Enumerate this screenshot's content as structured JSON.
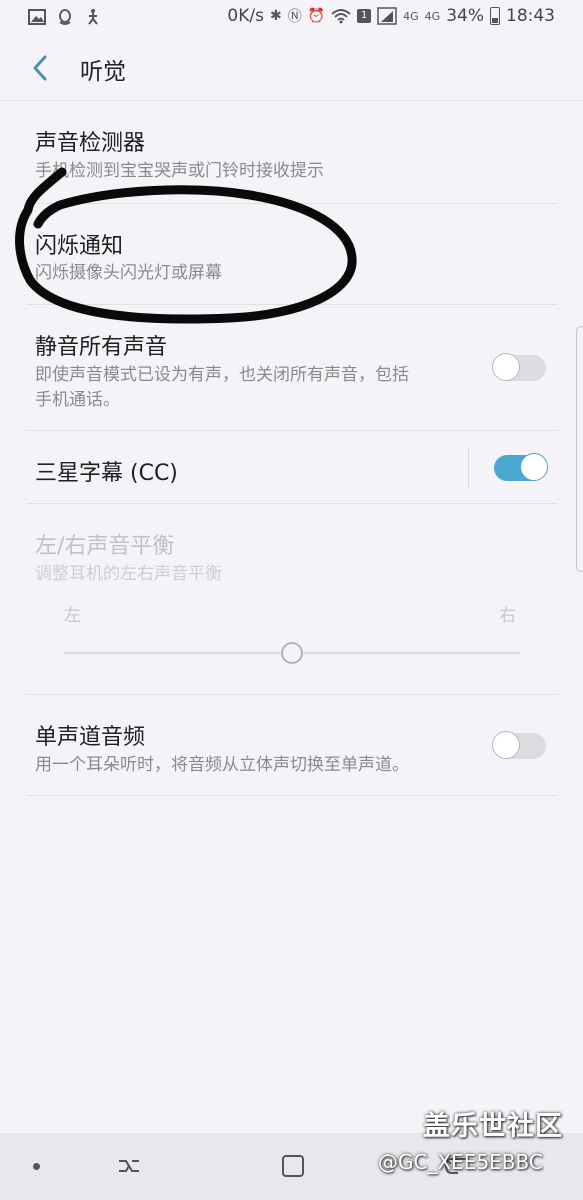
{
  "status_bar": {
    "speed": "0K/s",
    "network": "4G",
    "battery": "34%",
    "time": "18:43",
    "notif_count": "1"
  },
  "header": {
    "title": "听觉"
  },
  "items": [
    {
      "label": "声音检测器",
      "sub": "手机检测到宝宝哭声或门铃时接收提示"
    },
    {
      "label": "闪烁通知",
      "sub": "闪烁摄像头闪光灯或屏幕"
    },
    {
      "label": "静音所有声音",
      "sub_line1": "即使声音模式已设为有声，也关闭所有声音，包括",
      "sub_line2": "手机通话。",
      "toggle": "off"
    },
    {
      "label": "三星字幕 (CC)",
      "toggle": "on"
    },
    {
      "label": "左/右声音平衡",
      "sub": "调整耳机的左右声音平衡",
      "left": "左",
      "right": "右",
      "balance": 0.5
    },
    {
      "label": "单声道音频",
      "sub": "用一个耳朵听时，将音频从立体声切换至单声道。",
      "toggle": "off"
    }
  ],
  "watermark": {
    "site": "盖乐世社区",
    "user": "@GC_XEE5EBBC"
  },
  "colors": {
    "accent": "#4aa8d0",
    "background": "#f6f3f8"
  }
}
